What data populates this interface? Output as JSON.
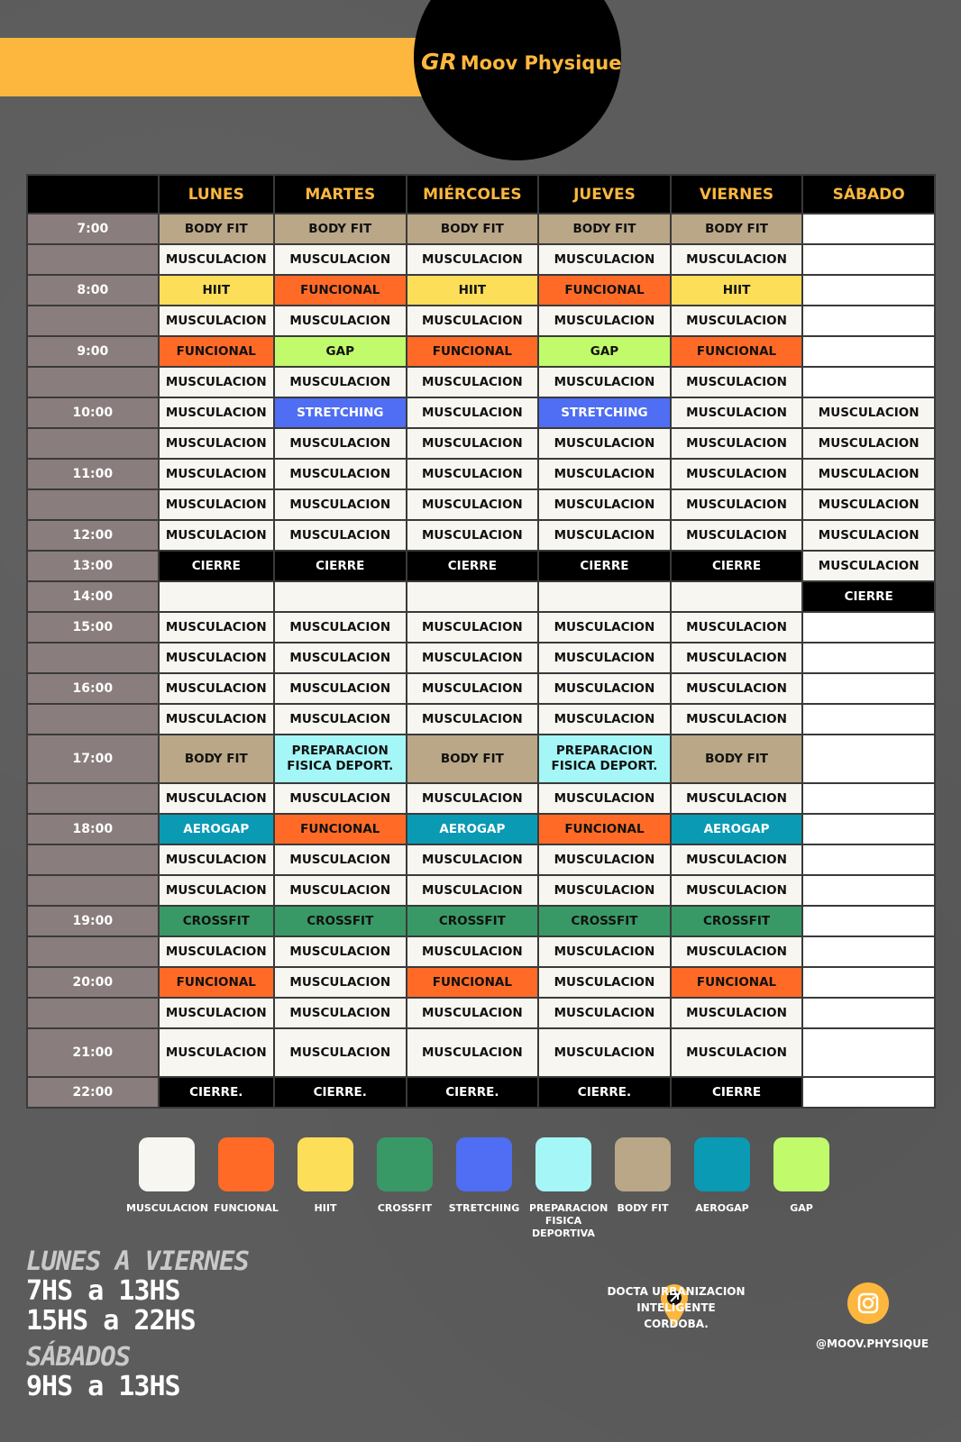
{
  "brand": {
    "gr": "GR",
    "name": "Moov Physique"
  },
  "days": [
    "LUNES",
    "MARTES",
    "MIÉRCOLES",
    "JUEVES",
    "VIERNES",
    "SÁBADO"
  ],
  "rows": [
    {
      "time": "7:00",
      "cells": [
        [
          "BODY FIT",
          "bf"
        ],
        [
          "BODY FIT",
          "bf"
        ],
        [
          "BODY FIT",
          "bf"
        ],
        [
          "BODY FIT",
          "bf"
        ],
        [
          "BODY FIT",
          "bf"
        ],
        [
          "",
          "e"
        ]
      ]
    },
    {
      "time": "",
      "cells": [
        [
          "MUSCULACION",
          "m"
        ],
        [
          "MUSCULACION",
          "m"
        ],
        [
          "MUSCULACION",
          "m"
        ],
        [
          "MUSCULACION",
          "m"
        ],
        [
          "MUSCULACION",
          "m"
        ],
        [
          "",
          "e"
        ]
      ]
    },
    {
      "time": "8:00",
      "cells": [
        [
          "HIIT",
          "hi"
        ],
        [
          "FUNCIONAL",
          "fu"
        ],
        [
          "HIIT",
          "hi"
        ],
        [
          "FUNCIONAL",
          "fu"
        ],
        [
          "HIIT",
          "hi"
        ],
        [
          "",
          "e"
        ]
      ]
    },
    {
      "time": "",
      "cells": [
        [
          "MUSCULACION",
          "m"
        ],
        [
          "MUSCULACION",
          "m"
        ],
        [
          "MUSCULACION",
          "m"
        ],
        [
          "MUSCULACION",
          "m"
        ],
        [
          "MUSCULACION",
          "m"
        ],
        [
          "",
          "e"
        ]
      ]
    },
    {
      "time": "9:00",
      "cells": [
        [
          "FUNCIONAL",
          "fu"
        ],
        [
          "GAP",
          "ga"
        ],
        [
          "FUNCIONAL",
          "fu"
        ],
        [
          "GAP",
          "ga"
        ],
        [
          "FUNCIONAL",
          "fu"
        ],
        [
          "",
          "e"
        ]
      ]
    },
    {
      "time": "",
      "cells": [
        [
          "MUSCULACION",
          "m"
        ],
        [
          "MUSCULACION",
          "m"
        ],
        [
          "MUSCULACION",
          "m"
        ],
        [
          "MUSCULACION",
          "m"
        ],
        [
          "MUSCULACION",
          "m"
        ],
        [
          "",
          "e"
        ]
      ]
    },
    {
      "time": "10:00",
      "cells": [
        [
          "MUSCULACION",
          "m"
        ],
        [
          "STRETCHING",
          "st"
        ],
        [
          "MUSCULACION",
          "m"
        ],
        [
          "STRETCHING",
          "st"
        ],
        [
          "MUSCULACION",
          "m"
        ],
        [
          "MUSCULACION",
          "m"
        ]
      ]
    },
    {
      "time": "",
      "cells": [
        [
          "MUSCULACION",
          "m"
        ],
        [
          "MUSCULACION",
          "m"
        ],
        [
          "MUSCULACION",
          "m"
        ],
        [
          "MUSCULACION",
          "m"
        ],
        [
          "MUSCULACION",
          "m"
        ],
        [
          "MUSCULACION",
          "m"
        ]
      ]
    },
    {
      "time": "11:00",
      "cells": [
        [
          "MUSCULACION",
          "m"
        ],
        [
          "MUSCULACION",
          "m"
        ],
        [
          "MUSCULACION",
          "m"
        ],
        [
          "MUSCULACION",
          "m"
        ],
        [
          "MUSCULACION",
          "m"
        ],
        [
          "MUSCULACION",
          "m"
        ]
      ]
    },
    {
      "time": "",
      "cells": [
        [
          "MUSCULACION",
          "m"
        ],
        [
          "MUSCULACION",
          "m"
        ],
        [
          "MUSCULACION",
          "m"
        ],
        [
          "MUSCULACION",
          "m"
        ],
        [
          "MUSCULACION",
          "m"
        ],
        [
          "MUSCULACION",
          "m"
        ]
      ]
    },
    {
      "time": "12:00",
      "cells": [
        [
          "MUSCULACION",
          "m"
        ],
        [
          "MUSCULACION",
          "m"
        ],
        [
          "MUSCULACION",
          "m"
        ],
        [
          "MUSCULACION",
          "m"
        ],
        [
          "MUSCULACION",
          "m"
        ],
        [
          "MUSCULACION",
          "m"
        ]
      ]
    },
    {
      "time": "13:00",
      "cells": [
        [
          "CIERRE",
          "ci"
        ],
        [
          "CIERRE",
          "ci"
        ],
        [
          "CIERRE",
          "ci"
        ],
        [
          "CIERRE",
          "ci"
        ],
        [
          "CIERRE",
          "ci"
        ],
        [
          "MUSCULACION",
          "m"
        ]
      ]
    },
    {
      "time": "14:00",
      "cells": [
        [
          "",
          "m"
        ],
        [
          "",
          "m"
        ],
        [
          "",
          "m"
        ],
        [
          "",
          "m"
        ],
        [
          "",
          "m"
        ],
        [
          "CIERRE",
          "ci"
        ]
      ]
    },
    {
      "time": "15:00",
      "cells": [
        [
          "MUSCULACION",
          "m"
        ],
        [
          "MUSCULACION",
          "m"
        ],
        [
          "MUSCULACION",
          "m"
        ],
        [
          "MUSCULACION",
          "m"
        ],
        [
          "MUSCULACION",
          "m"
        ],
        [
          "",
          "e"
        ]
      ]
    },
    {
      "time": "",
      "cells": [
        [
          "MUSCULACION",
          "m"
        ],
        [
          "MUSCULACION",
          "m"
        ],
        [
          "MUSCULACION",
          "m"
        ],
        [
          "MUSCULACION",
          "m"
        ],
        [
          "MUSCULACION",
          "m"
        ],
        [
          "",
          "e"
        ]
      ]
    },
    {
      "time": "16:00",
      "cells": [
        [
          "MUSCULACION",
          "m"
        ],
        [
          "MUSCULACION",
          "m"
        ],
        [
          "MUSCULACION",
          "m"
        ],
        [
          "MUSCULACION",
          "m"
        ],
        [
          "MUSCULACION",
          "m"
        ],
        [
          "",
          "e"
        ]
      ]
    },
    {
      "time": "",
      "cells": [
        [
          "MUSCULACION",
          "m"
        ],
        [
          "MUSCULACION",
          "m"
        ],
        [
          "MUSCULACION",
          "m"
        ],
        [
          "MUSCULACION",
          "m"
        ],
        [
          "MUSCULACION",
          "m"
        ],
        [
          "",
          "e"
        ]
      ]
    },
    {
      "time": "17:00",
      "tall": true,
      "cells": [
        [
          "BODY FIT",
          "bf"
        ],
        [
          "PREPARACION FISICA DEPORT.",
          "pr"
        ],
        [
          "BODY FIT",
          "bf"
        ],
        [
          "PREPARACION FISICA DEPORT.",
          "pr"
        ],
        [
          "BODY FIT",
          "bf"
        ],
        [
          "",
          "e"
        ]
      ]
    },
    {
      "time": "",
      "cells": [
        [
          "MUSCULACION",
          "m"
        ],
        [
          "MUSCULACION",
          "m"
        ],
        [
          "MUSCULACION",
          "m"
        ],
        [
          "MUSCULACION",
          "m"
        ],
        [
          "MUSCULACION",
          "m"
        ],
        [
          "",
          "e"
        ]
      ]
    },
    {
      "time": "18:00",
      "cells": [
        [
          "AEROGAP",
          "ae"
        ],
        [
          "FUNCIONAL",
          "fu"
        ],
        [
          "AEROGAP",
          "ae"
        ],
        [
          "FUNCIONAL",
          "fu"
        ],
        [
          "AEROGAP",
          "ae"
        ],
        [
          "",
          "e"
        ]
      ]
    },
    {
      "time": "",
      "cells": [
        [
          "MUSCULACION",
          "m"
        ],
        [
          "MUSCULACION",
          "m"
        ],
        [
          "MUSCULACION",
          "m"
        ],
        [
          "MUSCULACION",
          "m"
        ],
        [
          "MUSCULACION",
          "m"
        ],
        [
          "",
          "e"
        ]
      ]
    },
    {
      "time": "",
      "cells": [
        [
          "MUSCULACION",
          "m"
        ],
        [
          "MUSCULACION",
          "m"
        ],
        [
          "MUSCULACION",
          "m"
        ],
        [
          "MUSCULACION",
          "m"
        ],
        [
          "MUSCULACION",
          "m"
        ],
        [
          "",
          "e"
        ]
      ]
    },
    {
      "time": "19:00",
      "cells": [
        [
          "CROSSFIT",
          "cr"
        ],
        [
          "CROSSFIT",
          "cr"
        ],
        [
          "CROSSFIT",
          "cr"
        ],
        [
          "CROSSFIT",
          "cr"
        ],
        [
          "CROSSFIT",
          "cr"
        ],
        [
          "",
          "e"
        ]
      ]
    },
    {
      "time": "",
      "cells": [
        [
          "MUSCULACION",
          "m"
        ],
        [
          "MUSCULACION",
          "m"
        ],
        [
          "MUSCULACION",
          "m"
        ],
        [
          "MUSCULACION",
          "m"
        ],
        [
          "MUSCULACION",
          "m"
        ],
        [
          "",
          "e"
        ]
      ]
    },
    {
      "time": "20:00",
      "cells": [
        [
          "FUNCIONAL",
          "fu"
        ],
        [
          "MUSCULACION",
          "m"
        ],
        [
          "FUNCIONAL",
          "fu"
        ],
        [
          "MUSCULACION",
          "m"
        ],
        [
          "FUNCIONAL",
          "fu"
        ],
        [
          "",
          "e"
        ]
      ]
    },
    {
      "time": "",
      "cells": [
        [
          "MUSCULACION",
          "m"
        ],
        [
          "MUSCULACION",
          "m"
        ],
        [
          "MUSCULACION",
          "m"
        ],
        [
          "MUSCULACION",
          "m"
        ],
        [
          "MUSCULACION",
          "m"
        ],
        [
          "",
          "e"
        ]
      ]
    },
    {
      "time": "21:00",
      "tall": true,
      "cells": [
        [
          "MUSCULACION",
          "m"
        ],
        [
          "MUSCULACION",
          "m"
        ],
        [
          "MUSCULACION",
          "m"
        ],
        [
          "MUSCULACION",
          "m"
        ],
        [
          "MUSCULACION",
          "m"
        ],
        [
          "",
          "e"
        ]
      ]
    },
    {
      "time": "22:00",
      "cells": [
        [
          "CIERRE.",
          "ci"
        ],
        [
          "CIERRE.",
          "ci"
        ],
        [
          "CIERRE.",
          "ci"
        ],
        [
          "CIERRE.",
          "ci"
        ],
        [
          "CIERRE",
          "ci"
        ],
        [
          "",
          "e"
        ]
      ]
    }
  ],
  "legend": [
    {
      "label": "MUSCULACION",
      "color": "#f8f6f0"
    },
    {
      "label": "FUNCIONAL",
      "color": "#ff6b27"
    },
    {
      "label": "HIIT",
      "color": "#fdde58"
    },
    {
      "label": "CROSSFIT",
      "color": "#399966"
    },
    {
      "label": "STRETCHING",
      "color": "#4f6ef4"
    },
    {
      "label": "PREPARACION FISICA DEPORTIVA",
      "color": "#a4f6f7"
    },
    {
      "label": "BODY FIT",
      "color": "#b9a787"
    },
    {
      "label": "AEROGAP",
      "color": "#0a9ab4"
    },
    {
      "label": "GAP",
      "color": "#c1fb6c"
    }
  ],
  "hours": {
    "weekday_title": "LUNES A VIERNES",
    "weekday_1": "7HS a 13HS",
    "weekday_2": "15HS a 22HS",
    "saturday_title": "SÁBADOS",
    "saturday_1": "9HS a 13HS"
  },
  "location": {
    "line1": "DOCTA URBANIZACION INTELIGENTE",
    "line2": "CORDOBA."
  },
  "social": {
    "instagram": "@MOOV.PHYSIQUE"
  },
  "colors": {
    "accent": "#fdb73e",
    "background": "#5c5c5c",
    "time_column": "#8a7d7d"
  }
}
